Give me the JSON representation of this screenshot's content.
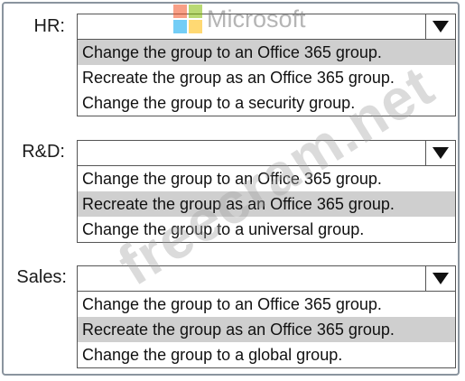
{
  "watermark": {
    "brand": "Microsoft",
    "site": "freecram.net",
    "logo_colors": [
      "#f25022",
      "#7fba00",
      "#00a4ef",
      "#ffb900"
    ]
  },
  "dropdowns": [
    {
      "label": "HR:",
      "selected_value": "",
      "options": [
        {
          "text": "Change the group to an Office 365 group.",
          "highlighted": true
        },
        {
          "text": "Recreate the group as an Office 365 group.",
          "highlighted": false
        },
        {
          "text": "Change the group to a security group.",
          "highlighted": false
        }
      ]
    },
    {
      "label": "R&D:",
      "selected_value": "",
      "options": [
        {
          "text": "Change the group to an Office 365 group.",
          "highlighted": false
        },
        {
          "text": "Recreate the group as an Office 365 group.",
          "highlighted": true
        },
        {
          "text": "Change the group to a universal group.",
          "highlighted": false
        }
      ]
    },
    {
      "label": "Sales:",
      "selected_value": "",
      "options": [
        {
          "text": "Change the group to an Office 365 group.",
          "highlighted": false
        },
        {
          "text": "Recreate the group as an Office 365 group.",
          "highlighted": true
        },
        {
          "text": "Change the group to a global group.",
          "highlighted": false
        }
      ]
    }
  ],
  "icons": {
    "dropdown_arrow": "triangle-down-icon"
  },
  "colors": {
    "highlight": "#cfcfcf",
    "border": "#555555",
    "frame": "#8a949e"
  }
}
